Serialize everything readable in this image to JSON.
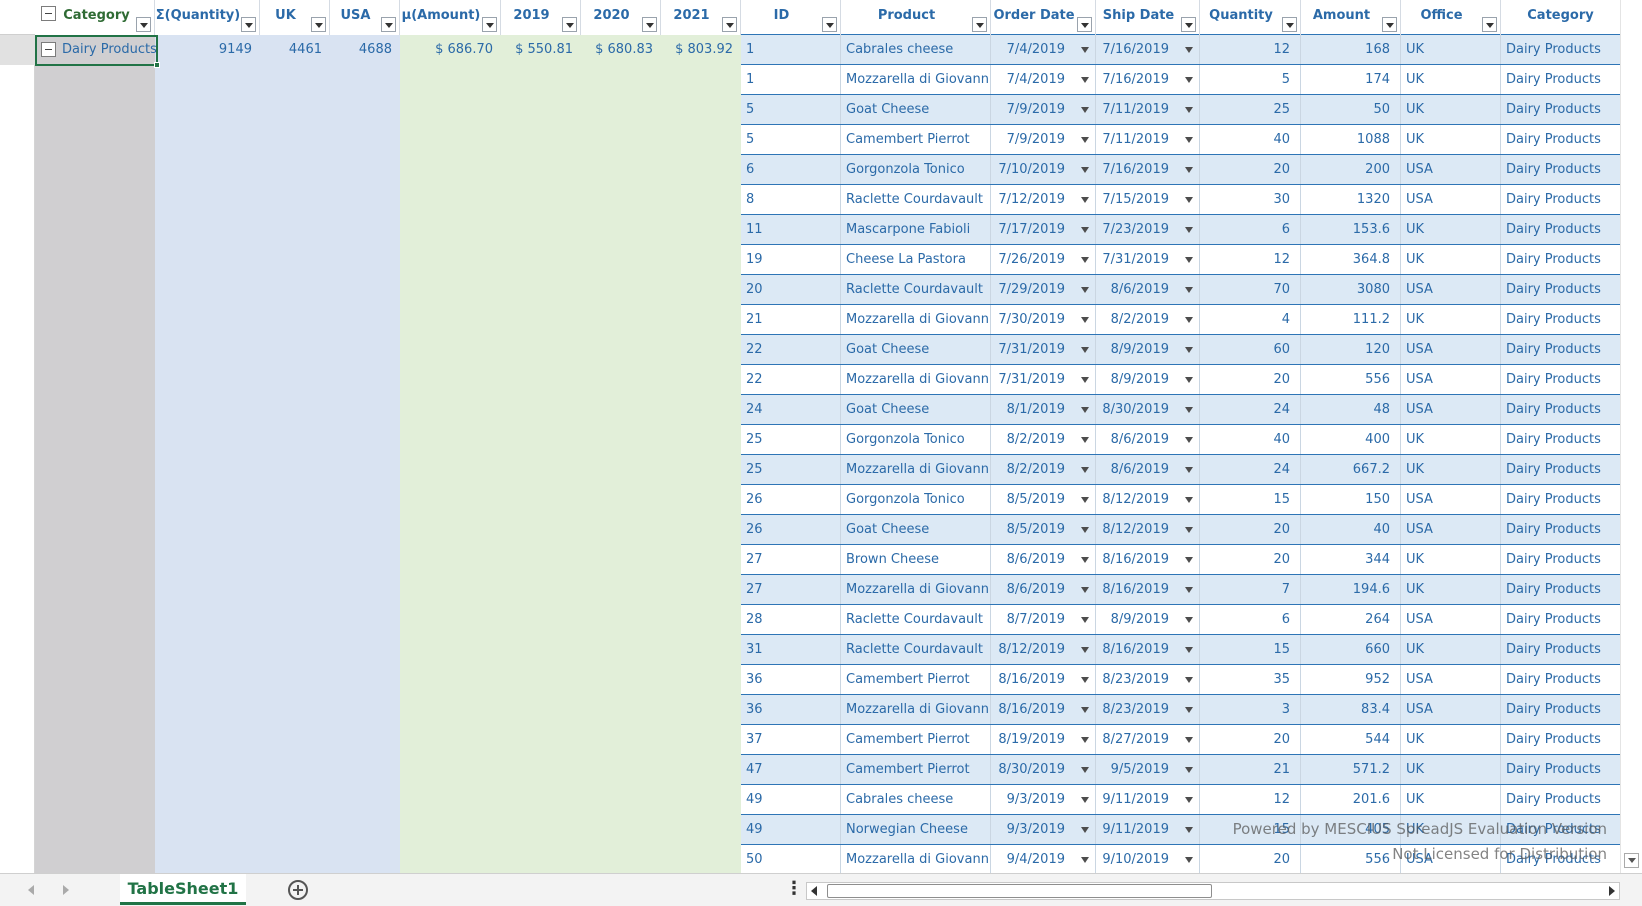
{
  "pivot": {
    "headers": [
      "Category",
      "Σ(Quantity)",
      "UK",
      "USA",
      "µ(Amount)",
      "2019",
      "2020",
      "2021"
    ],
    "row": {
      "category": "Dairy Products",
      "quantity": "9149",
      "uk": "4461",
      "usa": "4688",
      "amount": "$ 686.70",
      "y2019": "$ 550.81",
      "y2020": "$ 680.83",
      "y2021": "$ 803.92"
    }
  },
  "table": {
    "headers": [
      "ID",
      "Product",
      "Order Date",
      "Ship Date",
      "Quantity",
      "Amount",
      "Office",
      "Category"
    ],
    "rows": [
      [
        "1",
        "Cabrales cheese",
        "7/4/2019",
        "7/16/2019",
        "12",
        "168",
        "UK",
        "Dairy Products"
      ],
      [
        "1",
        "Mozzarella di Giovanni",
        "7/4/2019",
        "7/16/2019",
        "5",
        "174",
        "UK",
        "Dairy Products"
      ],
      [
        "5",
        "Goat Cheese",
        "7/9/2019",
        "7/11/2019",
        "25",
        "50",
        "UK",
        "Dairy Products"
      ],
      [
        "5",
        "Camembert Pierrot",
        "7/9/2019",
        "7/11/2019",
        "40",
        "1088",
        "UK",
        "Dairy Products"
      ],
      [
        "6",
        "Gorgonzola Tonico",
        "7/10/2019",
        "7/16/2019",
        "20",
        "200",
        "USA",
        "Dairy Products"
      ],
      [
        "8",
        "Raclette Courdavault",
        "7/12/2019",
        "7/15/2019",
        "30",
        "1320",
        "USA",
        "Dairy Products"
      ],
      [
        "11",
        "Mascarpone Fabioli",
        "7/17/2019",
        "7/23/2019",
        "6",
        "153.6",
        "UK",
        "Dairy Products"
      ],
      [
        "19",
        "Cheese La Pastora",
        "7/26/2019",
        "7/31/2019",
        "12",
        "364.8",
        "UK",
        "Dairy Products"
      ],
      [
        "20",
        "Raclette Courdavault",
        "7/29/2019",
        "8/6/2019",
        "70",
        "3080",
        "USA",
        "Dairy Products"
      ],
      [
        "21",
        "Mozzarella di Giovanni",
        "7/30/2019",
        "8/2/2019",
        "4",
        "111.2",
        "UK",
        "Dairy Products"
      ],
      [
        "22",
        "Goat Cheese",
        "7/31/2019",
        "8/9/2019",
        "60",
        "120",
        "USA",
        "Dairy Products"
      ],
      [
        "22",
        "Mozzarella di Giovanni",
        "7/31/2019",
        "8/9/2019",
        "20",
        "556",
        "USA",
        "Dairy Products"
      ],
      [
        "24",
        "Goat Cheese",
        "8/1/2019",
        "8/30/2019",
        "24",
        "48",
        "USA",
        "Dairy Products"
      ],
      [
        "25",
        "Gorgonzola Tonico",
        "8/2/2019",
        "8/6/2019",
        "40",
        "400",
        "UK",
        "Dairy Products"
      ],
      [
        "25",
        "Mozzarella di Giovanni",
        "8/2/2019",
        "8/6/2019",
        "24",
        "667.2",
        "UK",
        "Dairy Products"
      ],
      [
        "26",
        "Gorgonzola Tonico",
        "8/5/2019",
        "8/12/2019",
        "15",
        "150",
        "USA",
        "Dairy Products"
      ],
      [
        "26",
        "Goat Cheese",
        "8/5/2019",
        "8/12/2019",
        "20",
        "40",
        "USA",
        "Dairy Products"
      ],
      [
        "27",
        "Brown Cheese",
        "8/6/2019",
        "8/16/2019",
        "20",
        "344",
        "UK",
        "Dairy Products"
      ],
      [
        "27",
        "Mozzarella di Giovanni",
        "8/6/2019",
        "8/16/2019",
        "7",
        "194.6",
        "UK",
        "Dairy Products"
      ],
      [
        "28",
        "Raclette Courdavault",
        "8/7/2019",
        "8/9/2019",
        "6",
        "264",
        "USA",
        "Dairy Products"
      ],
      [
        "31",
        "Raclette Courdavault",
        "8/12/2019",
        "8/16/2019",
        "15",
        "660",
        "UK",
        "Dairy Products"
      ],
      [
        "36",
        "Camembert Pierrot",
        "8/16/2019",
        "8/23/2019",
        "35",
        "952",
        "USA",
        "Dairy Products"
      ],
      [
        "36",
        "Mozzarella di Giovanni",
        "8/16/2019",
        "8/23/2019",
        "3",
        "83.4",
        "USA",
        "Dairy Products"
      ],
      [
        "37",
        "Camembert Pierrot",
        "8/19/2019",
        "8/27/2019",
        "20",
        "544",
        "UK",
        "Dairy Products"
      ],
      [
        "47",
        "Camembert Pierrot",
        "8/30/2019",
        "9/5/2019",
        "21",
        "571.2",
        "UK",
        "Dairy Products"
      ],
      [
        "49",
        "Cabrales cheese",
        "9/3/2019",
        "9/11/2019",
        "12",
        "201.6",
        "UK",
        "Dairy Products"
      ],
      [
        "49",
        "Norwegian Cheese",
        "9/3/2019",
        "9/11/2019",
        "15",
        "405",
        "UK",
        "Dairy Products"
      ],
      [
        "50",
        "Mozzarella di Giovanni",
        "9/4/2019",
        "9/10/2019",
        "20",
        "556",
        "USA",
        "Dairy Products"
      ]
    ]
  },
  "sheet_tab": "TableSheet1",
  "watermark": {
    "line1": "Powered by MESCIUS SpreadJS Evaluation Version",
    "line2": "Not Licensed for Distribution"
  },
  "colors": {
    "accent": "#217346",
    "table_text": "#2b6aa8",
    "band": "#dce9f5",
    "pivot_category_bg": "#d0cfd1",
    "pivot_qty_bg": "#d9e3f2",
    "pivot_amount_bg": "#e2efd9"
  }
}
